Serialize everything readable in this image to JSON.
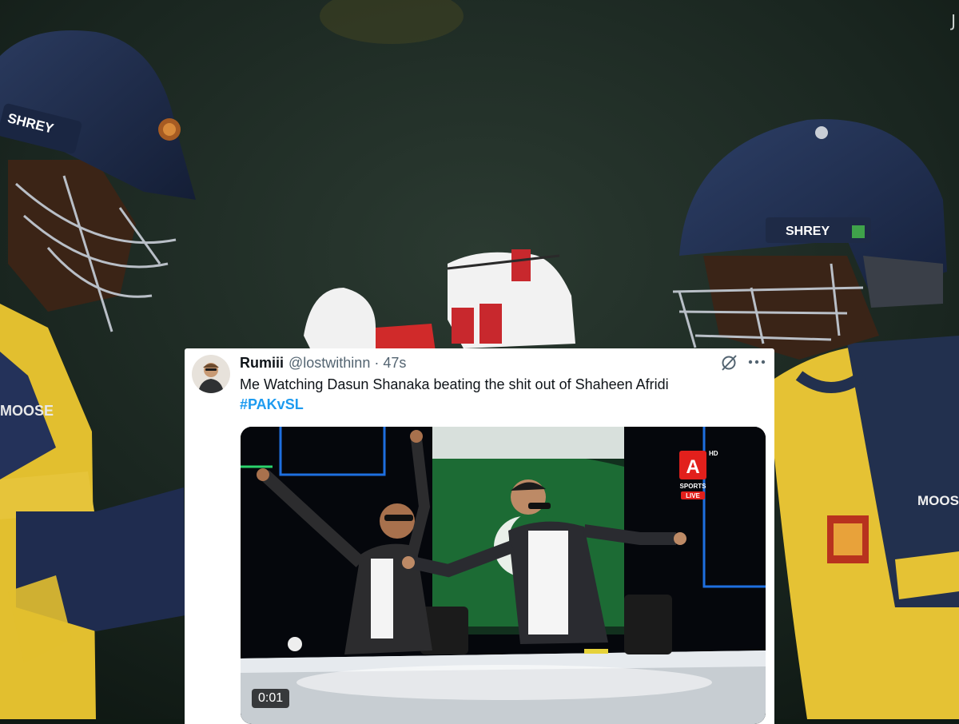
{
  "background": {
    "helmet_brand_left": "SHREY",
    "helmet_brand_right": "SHREY",
    "sleeve_sponsor_left": "MOOSE",
    "sleeve_sponsor_right": "MOOSE",
    "watermark": "J"
  },
  "tweet": {
    "display_name": "Rumiii",
    "handle": "@lostwithinn",
    "separator": "·",
    "time_ago": "47s",
    "text": "Me  Watching Dasun Shanaka beating the shit out of Shaheen Afridi",
    "hashtag": "#PAKvSL",
    "video": {
      "channel_logo_letter": "A",
      "channel_name": "SPORTS",
      "live_label": "LIVE",
      "hd_label": "HD",
      "duration": "0:01"
    }
  },
  "colors": {
    "hashtag_blue": "#1d9bf0",
    "jersey_yellow": "#e9c83a",
    "jersey_navy": "#22304e",
    "helmet_navy": "#1c2a48",
    "channel_red": "#e2201c"
  },
  "icons": [
    "grok-icon",
    "more-options-icon"
  ]
}
